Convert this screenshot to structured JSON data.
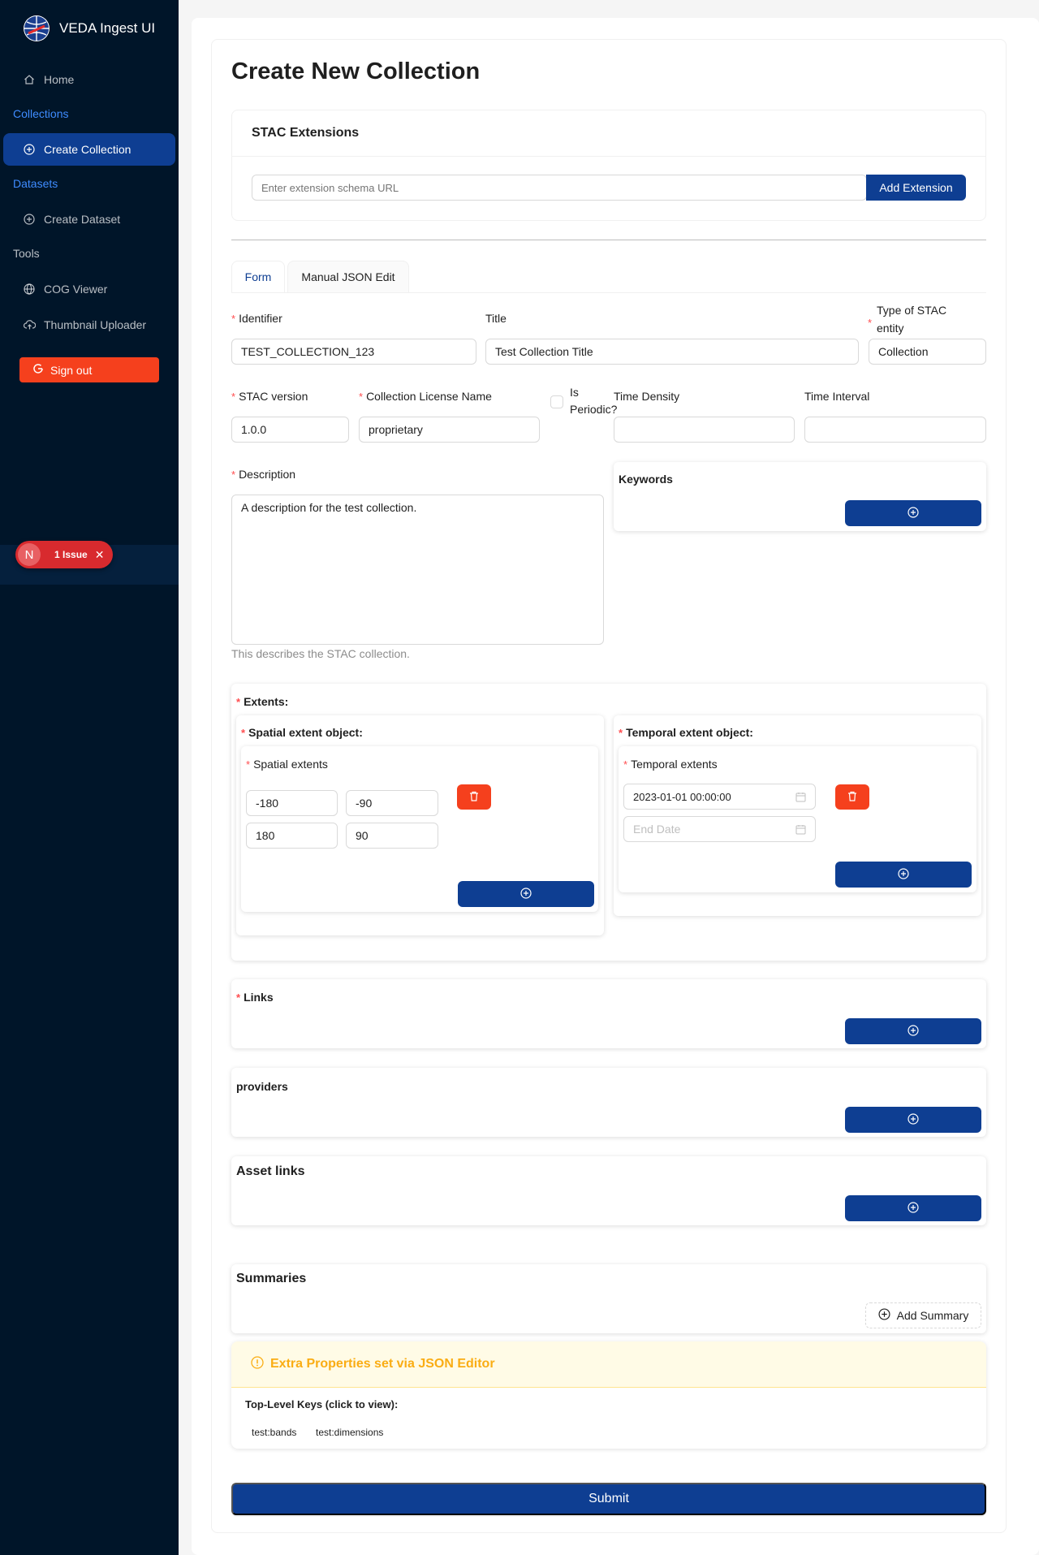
{
  "app": {
    "title": "VEDA Ingest UI"
  },
  "sidebar": {
    "home": "Home",
    "collections_group": "Collections",
    "create_collection": "Create Collection",
    "datasets_group": "Datasets",
    "create_dataset": "Create Dataset",
    "tools_group": "Tools",
    "cog_viewer": "COG Viewer",
    "thumbnail_uploader": "Thumbnail Uploader",
    "sign_out": "Sign out"
  },
  "dev_indicator": {
    "letter": "N",
    "label": "1 Issue",
    "close": "✕"
  },
  "page": {
    "title": "Create New Collection"
  },
  "stac_extensions": {
    "title": "STAC Extensions",
    "placeholder": "Enter extension schema URL",
    "add_button": "Add Extension"
  },
  "tabs": [
    {
      "label": "Form",
      "active": true
    },
    {
      "label": "Manual JSON Edit",
      "active": false
    }
  ],
  "form": {
    "identifier": {
      "label": "Identifier",
      "value": "TEST_COLLECTION_123"
    },
    "title": {
      "label": "Title",
      "value": "Test Collection Title"
    },
    "type": {
      "label_line1": "Type of STAC",
      "label_line2": "entity",
      "value": "Collection"
    },
    "stac_version": {
      "label": "STAC version",
      "value": "1.0.0"
    },
    "license": {
      "label": "Collection License Name",
      "value": "proprietary"
    },
    "is_periodic": {
      "label_line1": "Is",
      "label_line2": "Periodic?",
      "checked": false
    },
    "time_density": {
      "label": "Time Density",
      "value": ""
    },
    "time_interval": {
      "label": "Time Interval",
      "value": ""
    },
    "description": {
      "label": "Description",
      "value": "A description for the test collection.",
      "help": "This describes the STAC collection."
    },
    "keywords": {
      "title": "Keywords"
    },
    "extents": {
      "title": "Extents",
      "spatial": {
        "title": "Spatial extent object",
        "subtitle": "Spatial extents",
        "row1": [
          "-180",
          "-90"
        ],
        "row2": [
          "180",
          "90"
        ]
      },
      "temporal": {
        "title": "Temporal extent object",
        "subtitle": "Temporal extents",
        "start": "2023-01-01 00:00:00",
        "end_placeholder": "End Date"
      }
    },
    "links": {
      "title": "Links"
    },
    "providers": {
      "title": "providers"
    },
    "asset_links": {
      "title": "Asset links"
    },
    "summaries": {
      "title": "Summaries",
      "add_button": "Add Summary"
    },
    "extra_properties": {
      "title": "Extra Properties set via JSON Editor",
      "keys_label": "Top-Level Keys (click to view):",
      "keys": [
        "test:bands",
        "test:dimensions"
      ]
    },
    "colon": ":"
  },
  "submit": "Submit",
  "colors": {
    "sidebar": "#001529",
    "primary": "#0e3e92",
    "danger": "#f5401d",
    "warning": "#faad14",
    "link": "#3f8cff"
  }
}
